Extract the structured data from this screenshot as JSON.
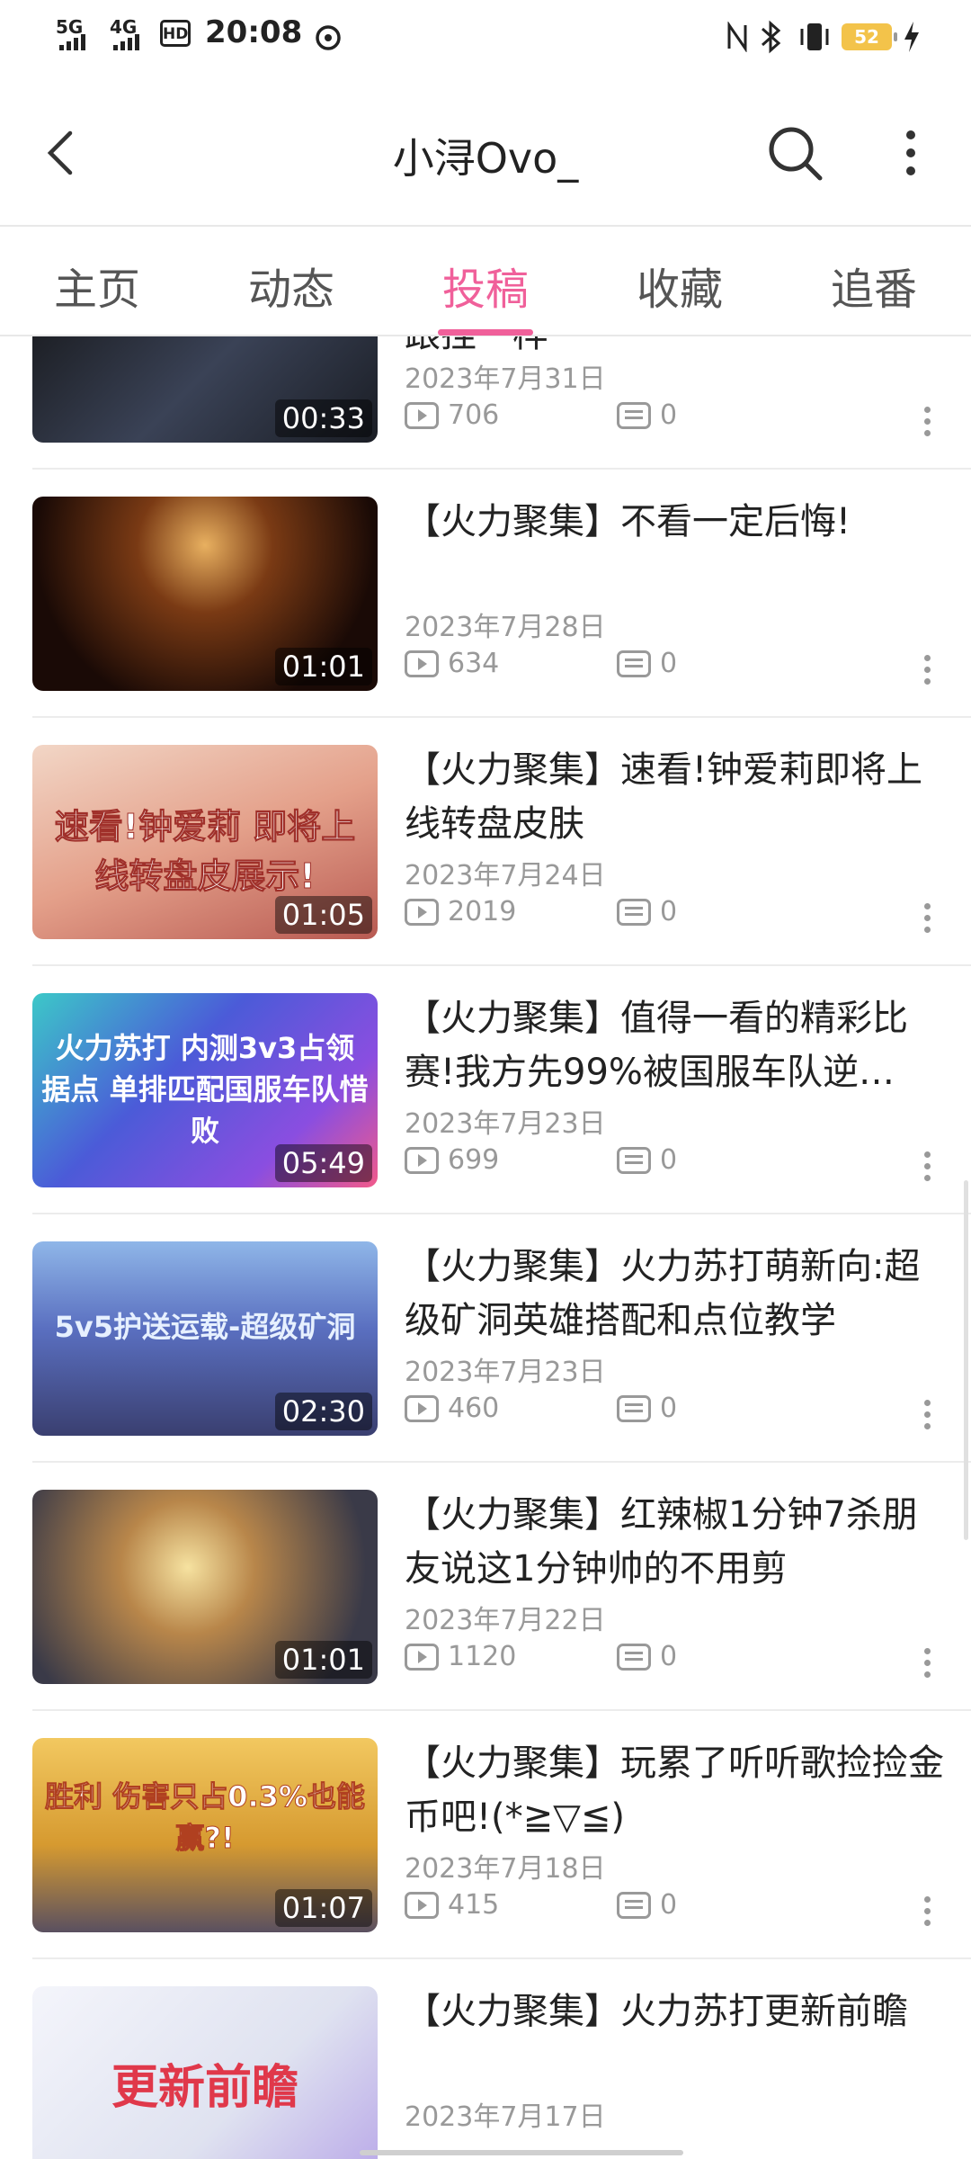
{
  "status_bar": {
    "time": "20:08",
    "network1": "5G",
    "network2": "4G",
    "hd": "HD",
    "battery": "52"
  },
  "header": {
    "title": "小浔Ovo_"
  },
  "tabs": [
    {
      "label": "主页"
    },
    {
      "label": "动态"
    },
    {
      "label": "投稿"
    },
    {
      "label": "收藏"
    },
    {
      "label": "追番"
    }
  ],
  "active_tab": "投稿",
  "videos": [
    {
      "title": "跟挂一样",
      "date": "2023年7月31日",
      "views": "706",
      "comments": "0",
      "duration": "00:33",
      "thumb_text": "",
      "thumb_color": "#2a2f3a"
    },
    {
      "title": "【火力聚集】不看一定后悔!",
      "date": "2023年7月28日",
      "views": "634",
      "comments": "0",
      "duration": "01:01",
      "thumb_text": "",
      "thumb_color": "#3a1c10"
    },
    {
      "title": "【火力聚集】速看!钟爱莉即将上线转盘皮肤",
      "date": "2023年7月24日",
      "views": "2019",
      "comments": "0",
      "duration": "01:05",
      "thumb_text": "速看!钟爱莉 即将上线转盘皮展示!",
      "thumb_color": "#d98a6a"
    },
    {
      "title": "【火力聚集】值得一看的精彩比赛!我方先99%被国服车队逆…",
      "date": "2023年7月23日",
      "views": "699",
      "comments": "0",
      "duration": "05:49",
      "thumb_text": "火力苏打 内测3v3占领据点 单排匹配国服车队惜败",
      "thumb_color": "#4b5bd8"
    },
    {
      "title": "【火力聚集】火力苏打萌新向:超级矿洞英雄搭配和点位教学",
      "date": "2023年7月23日",
      "views": "460",
      "comments": "0",
      "duration": "02:30",
      "thumb_text": "5v5护送运载-超级矿洞",
      "thumb_color": "#5a6fc0"
    },
    {
      "title": "【火力聚集】红辣椒1分钟7杀朋友说这1分钟帅的不用剪",
      "date": "2023年7月22日",
      "views": "1120",
      "comments": "0",
      "duration": "01:01",
      "thumb_text": "",
      "thumb_color": "#7a5a3a"
    },
    {
      "title": "【火力聚集】玩累了听听歌捡捡金币吧!(*≧▽≦)",
      "date": "2023年7月18日",
      "views": "415",
      "comments": "0",
      "duration": "01:07",
      "thumb_text": "胜利 伤害只占0.3%也能赢?!",
      "thumb_color": "#c9962e"
    },
    {
      "title": "【火力聚集】火力苏打更新前瞻",
      "date": "2023年7月17日",
      "views": "",
      "comments": "",
      "duration": "",
      "thumb_text": "更新前瞻",
      "thumb_color": "#e8eaf2"
    }
  ]
}
